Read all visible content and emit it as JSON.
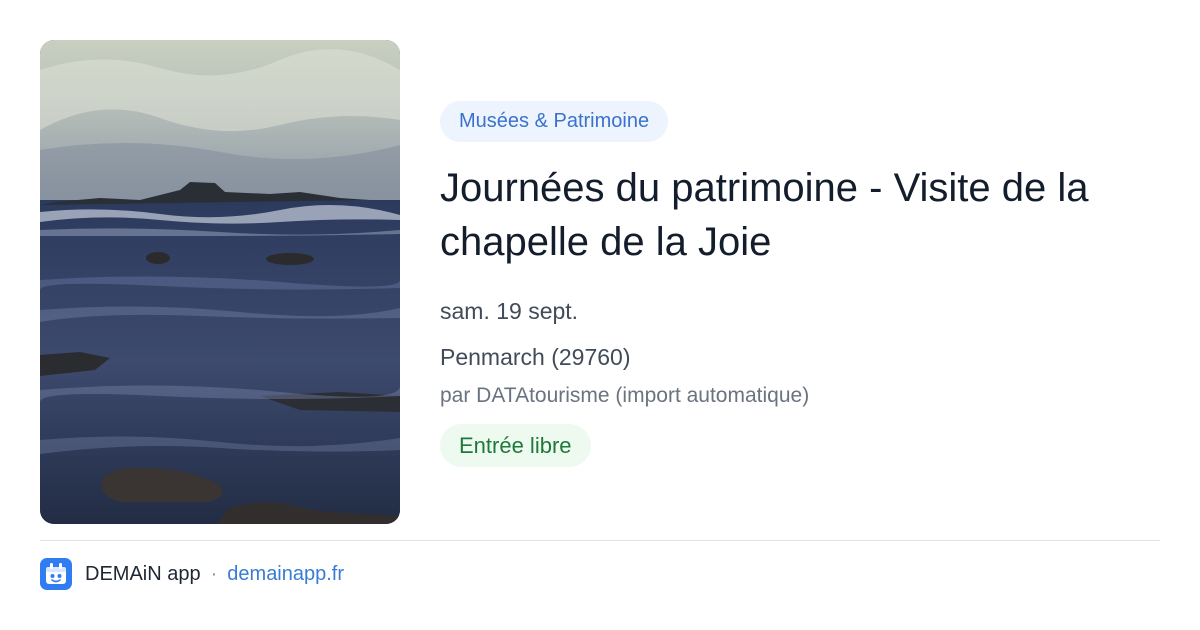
{
  "event": {
    "image_alt": "Rochers dans la mer à Penmarch",
    "category": "Musées & Patrimoine",
    "title": "Journées du patrimoine - Visite de la chapelle de la Joie",
    "date": "sam. 19 sept.",
    "location": "Penmarch (29760)",
    "source": "par DATAtourisme (import automatique)",
    "price": "Entrée libre"
  },
  "footer": {
    "app_icon": "app-logo-icon",
    "app_name": "DEMAiN app",
    "separator": "·",
    "app_url": "demainapp.fr"
  },
  "colors": {
    "category_bg": "#eef4fd",
    "category_text": "#3a72cc",
    "price_bg": "#eefaf0",
    "price_text": "#1f7a3a",
    "link": "#3a7bd5",
    "logo_bg": "#2f7df0"
  }
}
